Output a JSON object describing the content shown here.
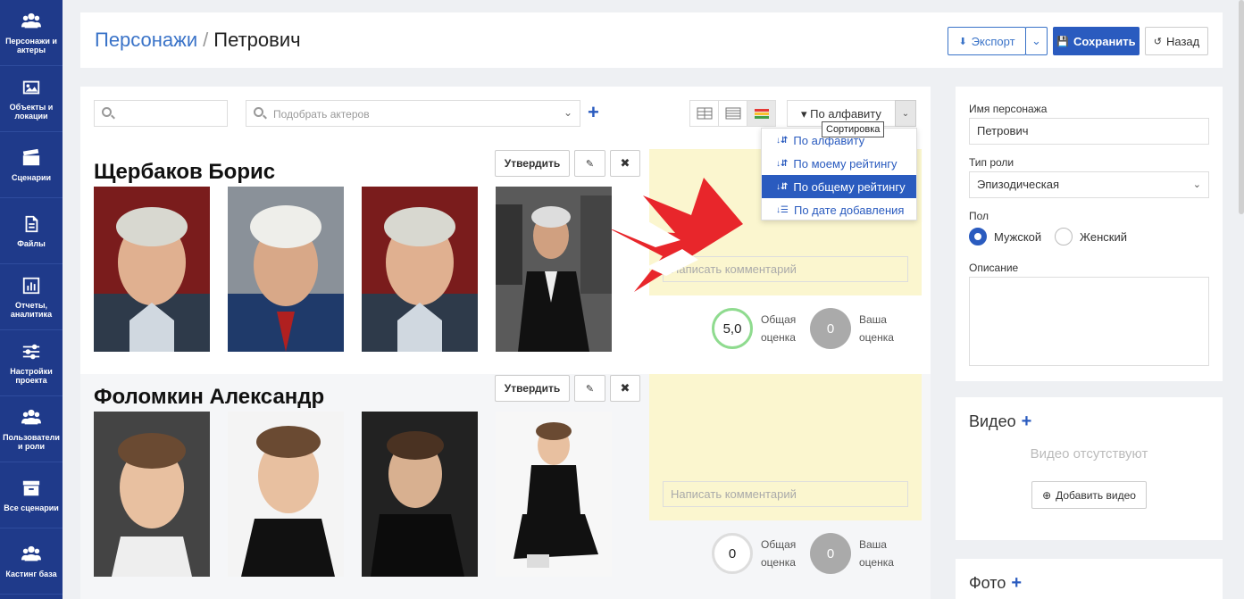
{
  "sidebar": {
    "items": [
      {
        "label": "Персонажи и актеры",
        "icon": "users-icon"
      },
      {
        "label": "Объекты и локации",
        "icon": "image-icon"
      },
      {
        "label": "Сценарии",
        "icon": "clapper-icon"
      },
      {
        "label": "Файлы",
        "icon": "file-icon"
      },
      {
        "label": "Отчеты, аналитика",
        "icon": "chart-icon"
      },
      {
        "label": "Настройки проекта",
        "icon": "sliders-icon"
      },
      {
        "label": "Пользователи и роли",
        "icon": "users-icon"
      },
      {
        "label": "Все сценарии",
        "icon": "archive-icon"
      },
      {
        "label": "Кастинг база",
        "icon": "users-icon"
      }
    ]
  },
  "header": {
    "breadcrumb_parent": "Персонажи",
    "breadcrumb_sep": "/",
    "breadcrumb_current": "Петрович",
    "export_label": "Экспорт",
    "save_label": "Сохранить",
    "back_label": "Назад"
  },
  "toolbar": {
    "search_placeholder": "",
    "actor_picker_placeholder": "Подобрать актеров",
    "sort_label": "По алфавиту",
    "sort_options": [
      "По алфавиту",
      "По моему рейтингу",
      "По общему рейтингу",
      "По дате добавления"
    ],
    "sort_selected_index": 2,
    "tooltip": "Сортировка"
  },
  "actors": [
    {
      "name": "Щербаков Борис",
      "approve_label": "Утвердить",
      "comment_placeholder": "Написать комментарий",
      "common_rating": "5,0",
      "common_rating_label_1": "Общая",
      "common_rating_label_2": "оценка",
      "my_rating": "0",
      "my_rating_label_1": "Ваша",
      "my_rating_label_2": "оценка"
    },
    {
      "name": "Фоломкин Александр",
      "approve_label": "Утвердить",
      "comment_placeholder": "Написать комментарий",
      "common_rating": "0",
      "common_rating_label_1": "Общая",
      "common_rating_label_2": "оценка",
      "my_rating": "0",
      "my_rating_label_1": "Ваша",
      "my_rating_label_2": "оценка"
    }
  ],
  "character": {
    "name_label": "Имя персонажа",
    "name_value": "Петрович",
    "role_type_label": "Тип роли",
    "role_type_value": "Эпизодическая",
    "gender_label": "Пол",
    "gender_male": "Мужской",
    "gender_female": "Женский",
    "gender_selected": "male",
    "description_label": "Описание"
  },
  "video": {
    "title": "Видео",
    "empty": "Видео отсутствуют",
    "add_label": "Добавить видео"
  },
  "photo": {
    "title": "Фото"
  },
  "colors": {
    "sidebar": "#1f3a8a",
    "primary": "#2a5bbf",
    "link": "#3a73c8",
    "comment_bg": "#fbf6cf",
    "arrow": "#e8262b"
  }
}
